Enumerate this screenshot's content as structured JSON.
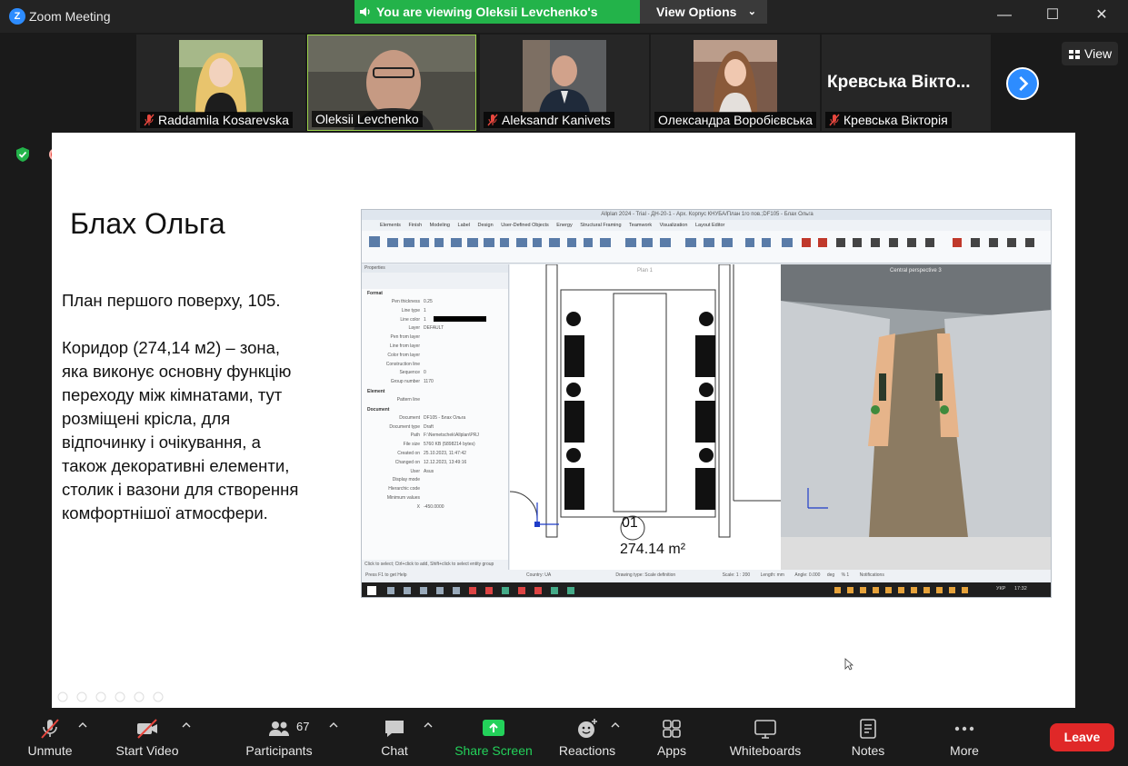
{
  "window": {
    "app_title": "Zoom Meeting",
    "logo_letter": "Z",
    "minimize_glyph": "—",
    "maximize_glyph": "☐",
    "close_glyph": "✕"
  },
  "banner": {
    "viewing_text": "You are viewing Oleksii Levchenko's screen",
    "view_options_label": "View Options",
    "view_options_chevron": "⌄"
  },
  "gallery": {
    "view_button_label": "View",
    "participants": [
      {
        "name": "Raddamila Kosarevska",
        "muted": true
      },
      {
        "name": "Oleksii Levchenko",
        "muted": false,
        "active_speaker": true
      },
      {
        "name": "Aleksandr Kanivets",
        "muted": true
      },
      {
        "name": "Олександра Воробієвська",
        "muted": false
      },
      {
        "name": "Кревська Вікторія",
        "muted": true,
        "display_text": "Кревська Вікто..."
      }
    ]
  },
  "slide": {
    "title": "Блах Ольга",
    "paragraph_1": "План першого поверху, 105.",
    "paragraph_2": "Коридор (274,14 м2) – зона, яка  виконує основну функцію переходу між кімнатами, тут розміщені крісла, для відпочинку і очікування, а також декоративні елементи, столик і вазони для створення комфортнішої атмосфери.",
    "room_number": "01",
    "room_area": "274.14 m²"
  },
  "allplan": {
    "title": "Allplan 2024 - Trial - ДН-20-1 - Арх. Корпус КНУБА/План 1го пов.;DF105 - Блах Ольга",
    "tabs": [
      "Elements",
      "Finish",
      "Modeling",
      "Label",
      "Design",
      "User-Defined Objects",
      "Energy",
      "Structural Framing",
      "Teamwork",
      "Visualization",
      "Layout Editor"
    ],
    "properties_title": "Properties",
    "sections": [
      "Format",
      "Element",
      "Document"
    ],
    "format_rows": [
      {
        "key": "Pen thickness",
        "value": "0.25"
      },
      {
        "key": "Line type",
        "value": "1"
      },
      {
        "key": "Line color",
        "value": "1"
      },
      {
        "key": "Layer",
        "value": "DEFAULT"
      },
      {
        "key": "Pen from layer",
        "value": ""
      },
      {
        "key": "Line from layer",
        "value": ""
      },
      {
        "key": "Color from layer",
        "value": ""
      },
      {
        "key": "Construction line",
        "value": ""
      },
      {
        "key": "Sequence",
        "value": "0"
      },
      {
        "key": "Group number",
        "value": "1170"
      }
    ],
    "element_rows": [
      {
        "key": "Pattern line",
        "value": ""
      }
    ],
    "document_rows": [
      {
        "key": "Document",
        "value": "DF105 - Блах Ольга"
      },
      {
        "key": "Document type",
        "value": "Draft"
      },
      {
        "key": "Path",
        "value": "F:\\Nemetschek\\Allplan\\PRJ"
      },
      {
        "key": "File size",
        "value": "5760 KB (5898214 bytes)"
      },
      {
        "key": "Created on",
        "value": "25.10.2023, 11:47:42"
      },
      {
        "key": "Changed on",
        "value": "12.12.2023, 13:49:16"
      },
      {
        "key": "User",
        "value": "Asus"
      },
      {
        "key": "Display mode",
        "value": ""
      },
      {
        "key": "Hierarchic code",
        "value": ""
      },
      {
        "key": "Minimum values",
        "value": ""
      },
      {
        "key": "X",
        "value": "-450.0000"
      }
    ],
    "plan_label": "Plan 1",
    "view3d_label": "Central perspective 3",
    "selection_hint": "Click to select; Ctrl+click to add, Shift+click to select entity group",
    "status_left": "Press F1 to get Help",
    "status_country": "Country: UA",
    "status_drawing": "Drawing type: Scale definition",
    "status_scale": "Scale: 1 : 200",
    "status_length": "Length: mm",
    "status_angle": "Angle: 0.000",
    "status_deg": "deg",
    "status_pct": "% 1",
    "status_notifications": "Notifications",
    "taskbar_lang": "УКР",
    "taskbar_time": "17:32"
  },
  "toolbar": {
    "unmute": "Unmute",
    "start_video": "Start Video",
    "participants": "Participants",
    "participants_count": "67",
    "chat": "Chat",
    "share_screen": "Share Screen",
    "reactions": "Reactions",
    "apps": "Apps",
    "whiteboards": "Whiteboards",
    "notes": "Notes",
    "more": "More",
    "leave": "Leave"
  },
  "colors": {
    "banner_green": "#23b34a",
    "share_green": "#23d15a",
    "leave_red": "#e02828",
    "zoom_blue": "#2d8cff",
    "active_border": "#9bd34a"
  }
}
